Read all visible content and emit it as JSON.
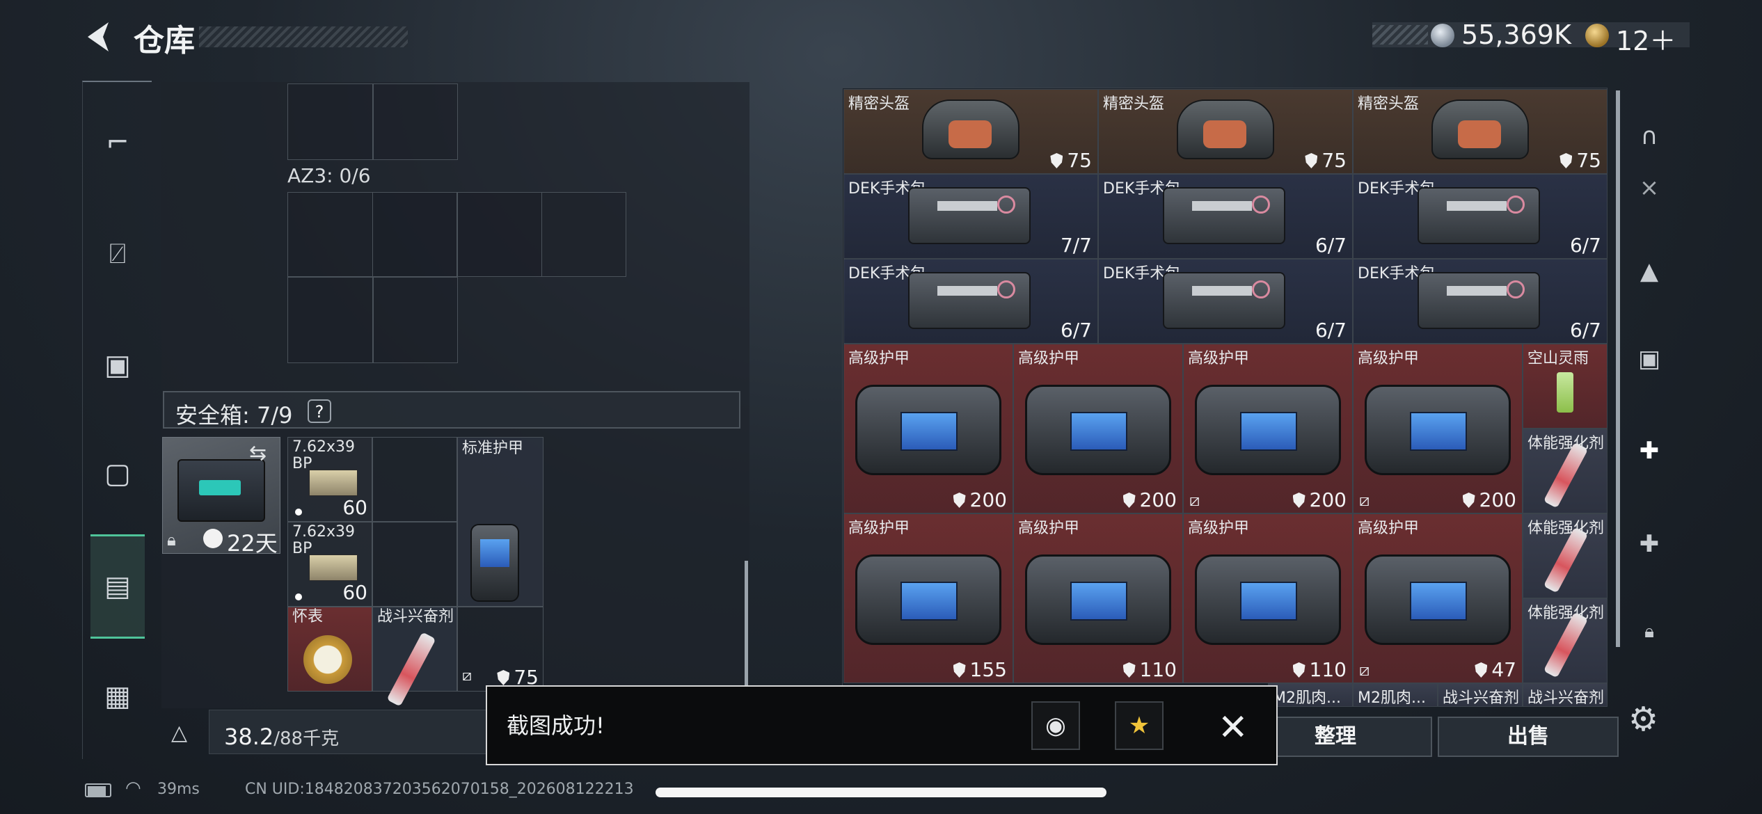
{
  "header": {
    "title": "仓库",
    "currency1": "55,369K",
    "currency2": "12＋"
  },
  "left_rail": {
    "icons": [
      "gun-icon",
      "vest-icon",
      "backpack-icon",
      "pouch-icon",
      "safe-box-icon",
      "briefcase-icon"
    ]
  },
  "container": {
    "label": "AZ3: 0/6"
  },
  "safe_box": {
    "label": "安全箱: 7/9",
    "help": "?",
    "days": "22天"
  },
  "safe_items": [
    {
      "name": "7.62x39\nBP",
      "count": "60"
    },
    {
      "name": "7.62x39\nBP",
      "count": "60"
    },
    {
      "name": "标准护甲",
      "value": "75"
    },
    {
      "name": "怀表"
    },
    {
      "name": "战斗兴奋剂"
    }
  ],
  "weight": {
    "value": "38.2",
    "max": "/88千克"
  },
  "grid_rows": [
    [
      {
        "name": "精密头盔",
        "value": "75",
        "kind": "helmet"
      },
      {
        "name": "精密头盔",
        "value": "75",
        "kind": "helmet"
      },
      {
        "name": "精密头盔",
        "value": "75",
        "kind": "helmet"
      }
    ],
    [
      {
        "name": "DEK手术包",
        "value": "7/7",
        "kind": "kit"
      },
      {
        "name": "DEK手术包",
        "value": "6/7",
        "kind": "kit"
      },
      {
        "name": "DEK手术包",
        "value": "6/7",
        "kind": "kit"
      }
    ],
    [
      {
        "name": "DEK手术包",
        "value": "6/7",
        "kind": "kit"
      },
      {
        "name": "DEK手术包",
        "value": "6/7",
        "kind": "kit"
      },
      {
        "name": "DEK手术包",
        "value": "6/7",
        "kind": "kit"
      }
    ]
  ],
  "armor_rows": [
    [
      {
        "name": "高级护甲",
        "value": "200",
        "restricted": false
      },
      {
        "name": "高级护甲",
        "value": "200",
        "restricted": false
      },
      {
        "name": "高级护甲",
        "value": "200",
        "restricted": true
      },
      {
        "name": "高级护甲",
        "value": "200",
        "restricted": true
      }
    ],
    [
      {
        "name": "高级护甲",
        "value": "155",
        "restricted": false
      },
      {
        "name": "高级护甲",
        "value": "110",
        "restricted": false
      },
      {
        "name": "高级护甲",
        "value": "110",
        "restricted": false
      },
      {
        "name": "高级护甲",
        "value": "47",
        "restricted": true
      }
    ]
  ],
  "side_items": [
    "空山灵雨",
    "体能强化剂",
    "体能强化剂",
    "体能强化剂"
  ],
  "bottom_row": [
    "M2肌肉...",
    "M2肌肉...",
    "战斗兴奋剂",
    "战斗兴奋剂"
  ],
  "buttons": {
    "sort": "整理",
    "sell": "出售"
  },
  "toast": {
    "text": "截图成功!"
  },
  "status": {
    "ping": "39ms",
    "uid": "CN UID:18482083720356207015​8_202608122213"
  },
  "colors": {
    "accent": "#4fc49a",
    "armor_bg": "#6a2e30",
    "helmet_bg": "#4a3a30",
    "kit_bg": "#2a3145"
  }
}
